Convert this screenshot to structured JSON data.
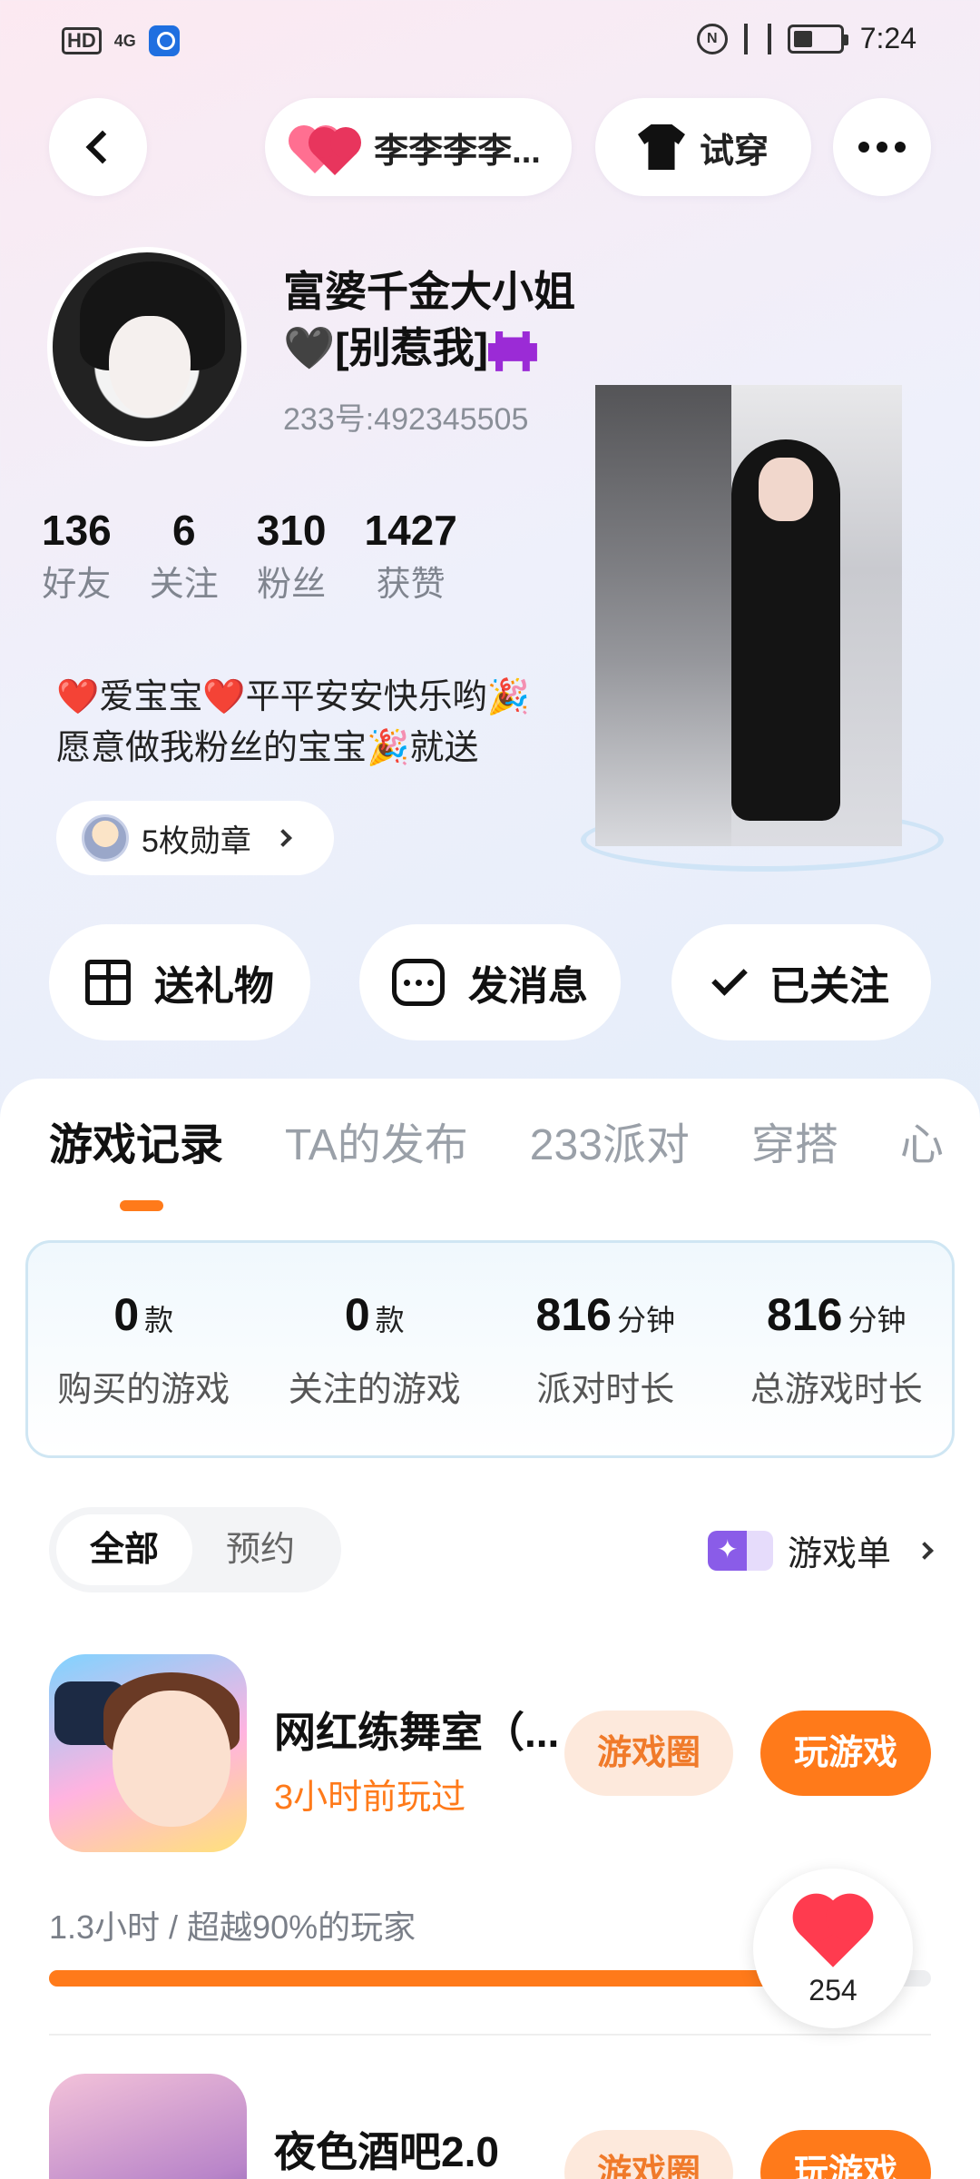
{
  "status_bar": {
    "hd": "HD",
    "signal": "4G",
    "time": "7:24",
    "nfc_icon": "nfc-icon",
    "battery": "battery-icon"
  },
  "top_nav": {
    "couple_name": "李李李李...",
    "try_on_label": "试穿"
  },
  "profile": {
    "nickname_line1": "富婆千金大小姐",
    "nickname_line2": "🖤[别惹我]",
    "uid": "233号:492345505",
    "stats": [
      {
        "value": "136",
        "label": "好友"
      },
      {
        "value": "6",
        "label": "关注"
      },
      {
        "value": "310",
        "label": "粉丝"
      },
      {
        "value": "1427",
        "label": "获赞"
      }
    ],
    "bio_line1": "❤️爱宝宝❤️平平安安快乐哟🎉",
    "bio_line2": "愿意做我粉丝的宝宝🎉就送",
    "medals": "5枚勋章"
  },
  "actions": {
    "gift": "送礼物",
    "message": "发消息",
    "followed": "已关注"
  },
  "tabs": [
    "游戏记录",
    "TA的发布",
    "233派对",
    "穿搭",
    "心"
  ],
  "game_stats": [
    {
      "value": "0",
      "unit": "款",
      "label": "购买的游戏"
    },
    {
      "value": "0",
      "unit": "款",
      "label": "关注的游戏"
    },
    {
      "value": "816",
      "unit": "分钟",
      "label": "派对时长"
    },
    {
      "value": "816",
      "unit": "分钟",
      "label": "总游戏时长"
    }
  ],
  "filter": {
    "all": "全部",
    "reserve": "预约",
    "game_list": "游戏单"
  },
  "games": [
    {
      "name": "网红练舞室（...",
      "subtitle": "3小时前玩过",
      "circle_btn": "游戏圈",
      "play_btn": "玩游戏",
      "stat": "1.3小时 / 超越90%的玩家",
      "progress": 0.9
    },
    {
      "name": "夜色酒吧2.0",
      "circle_btn": "游戏圈",
      "play_btn": "玩游戏"
    }
  ],
  "like_count": "254",
  "colors": {
    "accent": "#ff7a1a",
    "heart": "#ff3b4f"
  }
}
